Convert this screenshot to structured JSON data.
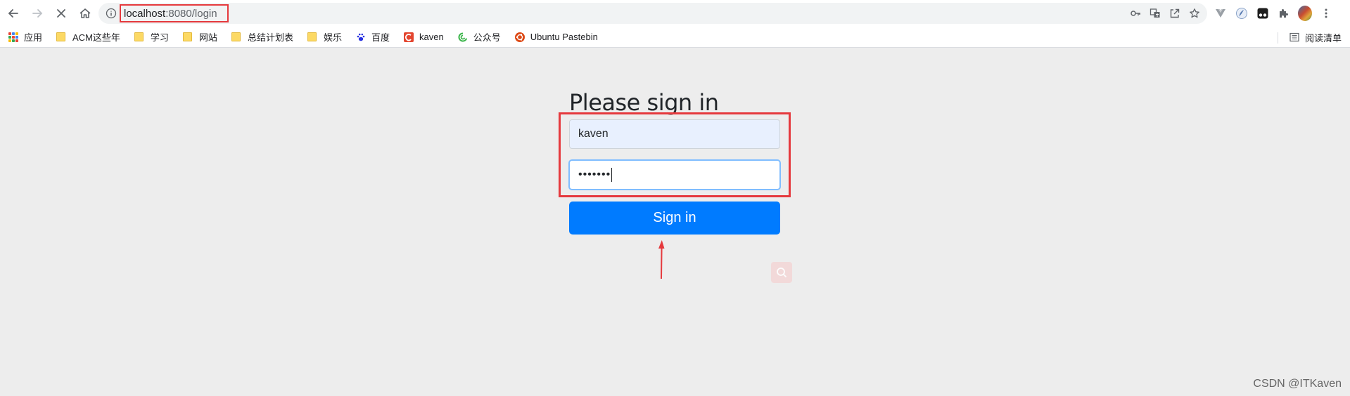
{
  "browser": {
    "url_host": "localhost",
    "url_path": ":8080/login"
  },
  "bookmarks": [
    {
      "label": "应用",
      "type": "apps"
    },
    {
      "label": "ACM这些年",
      "type": "folder"
    },
    {
      "label": "学习",
      "type": "folder"
    },
    {
      "label": "网站",
      "type": "folder"
    },
    {
      "label": "总结计划表",
      "type": "folder"
    },
    {
      "label": "娱乐",
      "type": "folder"
    },
    {
      "label": "百度",
      "type": "site",
      "icon": "baidu-icon",
      "color": "#2932e1"
    },
    {
      "label": "kaven",
      "type": "site",
      "icon": "csdn-icon",
      "color": "#e3452f"
    },
    {
      "label": "公众号",
      "type": "site",
      "icon": "wechat-icon",
      "color": "#3bb54a"
    },
    {
      "label": "Ubuntu Pastebin",
      "type": "site",
      "icon": "ubuntu-icon",
      "color": "#dd4814"
    }
  ],
  "reading_list": "阅读清单",
  "login": {
    "heading": "Please sign in",
    "username_value": "kaven",
    "password_mask": "•••••••",
    "submit_label": "Sign in"
  },
  "colors": {
    "primary": "#007bff",
    "highlight": "#e5393d",
    "autofill": "#e8f0fe"
  },
  "watermark": "CSDN @ITKaven"
}
